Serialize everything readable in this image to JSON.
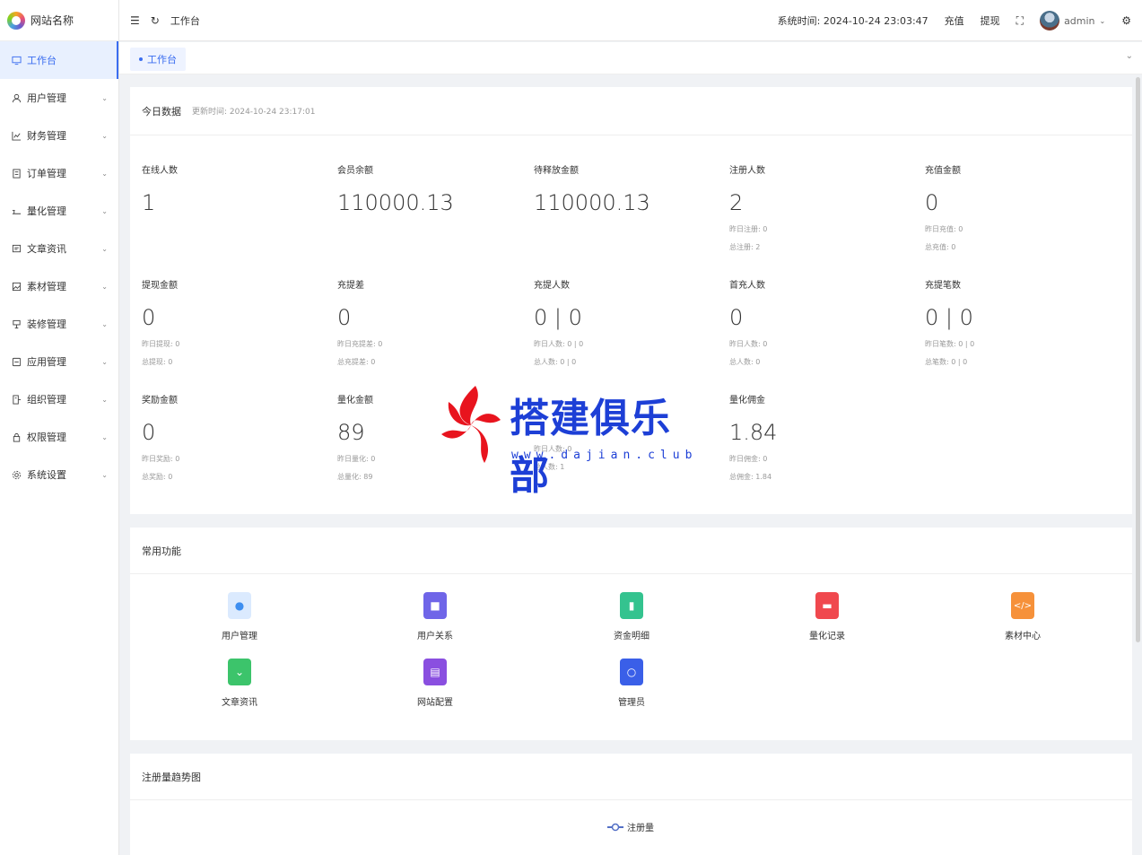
{
  "site": {
    "name": "网站名称"
  },
  "sidebar": {
    "items": [
      {
        "label": "工作台",
        "icon": "monitor-icon",
        "active": true
      },
      {
        "label": "用户管理",
        "icon": "user-icon"
      },
      {
        "label": "财务管理",
        "icon": "chart-icon"
      },
      {
        "label": "订单管理",
        "icon": "order-icon"
      },
      {
        "label": "量化管理",
        "icon": "quant-icon"
      },
      {
        "label": "文章资讯",
        "icon": "article-icon"
      },
      {
        "label": "素材管理",
        "icon": "image-icon"
      },
      {
        "label": "装修管理",
        "icon": "decor-icon"
      },
      {
        "label": "应用管理",
        "icon": "app-icon"
      },
      {
        "label": "组织管理",
        "icon": "org-icon"
      },
      {
        "label": "权限管理",
        "icon": "lock-icon"
      },
      {
        "label": "系统设置",
        "icon": "gear-icon"
      }
    ]
  },
  "header": {
    "breadcrumb": "工作台",
    "system_time": "系统时间: 2024-10-24 23:03:47",
    "recharge": "充值",
    "withdraw": "提现",
    "username": "admin"
  },
  "tabs": {
    "active": "工作台"
  },
  "today": {
    "title": "今日数据",
    "updated": "更新时间: 2024-10-24 23:17:01",
    "stats": [
      {
        "label": "在线人数",
        "value": "1",
        "subs": []
      },
      {
        "label": "会员余额",
        "value": "110000.13",
        "subs": []
      },
      {
        "label": "待释放金额",
        "value": "110000.13",
        "subs": []
      },
      {
        "label": "注册人数",
        "value": "2",
        "subs": [
          "昨日注册: 0",
          "总注册: 2"
        ]
      },
      {
        "label": "充值金额",
        "value": "0",
        "subs": [
          "昨日充值: 0",
          "总充值: 0"
        ]
      },
      {
        "label": "提现金额",
        "value": "0",
        "subs": [
          "昨日提现: 0",
          "总提现: 0"
        ]
      },
      {
        "label": "充提差",
        "value": "0",
        "subs": [
          "昨日充提差: 0",
          "总充提差: 0"
        ]
      },
      {
        "label": "充提人数",
        "value": "0 | 0",
        "subs": [
          "昨日人数: 0 | 0",
          "总人数: 0 | 0"
        ]
      },
      {
        "label": "首充人数",
        "value": "0",
        "subs": [
          "昨日人数: 0",
          "总人数: 0"
        ]
      },
      {
        "label": "充提笔数",
        "value": "0 | 0",
        "subs": [
          "昨日笔数: 0 | 0",
          "总笔数: 0 | 0"
        ]
      },
      {
        "label": "奖励金额",
        "value": "0",
        "subs": [
          "昨日奖励: 0",
          "总奖励: 0"
        ]
      },
      {
        "label": "量化金额",
        "value": "89",
        "subs": [
          "昨日量化: 0",
          "总量化: 89"
        ]
      },
      {
        "label": "",
        "value": "",
        "subs": [
          "昨日人数: 0",
          "总人数: 1"
        ]
      },
      {
        "label": "量化佣金",
        "value": "1.84",
        "subs": [
          "昨日佣金: 0",
          "总佣金: 1.84"
        ]
      }
    ]
  },
  "functions": {
    "title": "常用功能",
    "items": [
      {
        "label": "用户管理",
        "icon": "users-icon",
        "color": "#3d8ef0"
      },
      {
        "label": "用户关系",
        "icon": "relation-icon",
        "color": "#6f65e8"
      },
      {
        "label": "资金明细",
        "icon": "funds-icon",
        "color": "#34c38f"
      },
      {
        "label": "量化记录",
        "icon": "records-icon",
        "color": "#f0484e"
      },
      {
        "label": "素材中心",
        "icon": "code-icon",
        "color": "#f6913a"
      },
      {
        "label": "文章资讯",
        "icon": "box-icon",
        "color": "#3cc46b"
      },
      {
        "label": "网站配置",
        "icon": "config-icon",
        "color": "#8a4fe0"
      },
      {
        "label": "管理员",
        "icon": "admin-icon",
        "color": "#3a5fe8"
      }
    ]
  },
  "trend": {
    "title": "注册量趋势图",
    "legend": "注册量"
  },
  "watermark": {
    "text": "搭建俱乐部",
    "url": "www.dajian.club"
  }
}
